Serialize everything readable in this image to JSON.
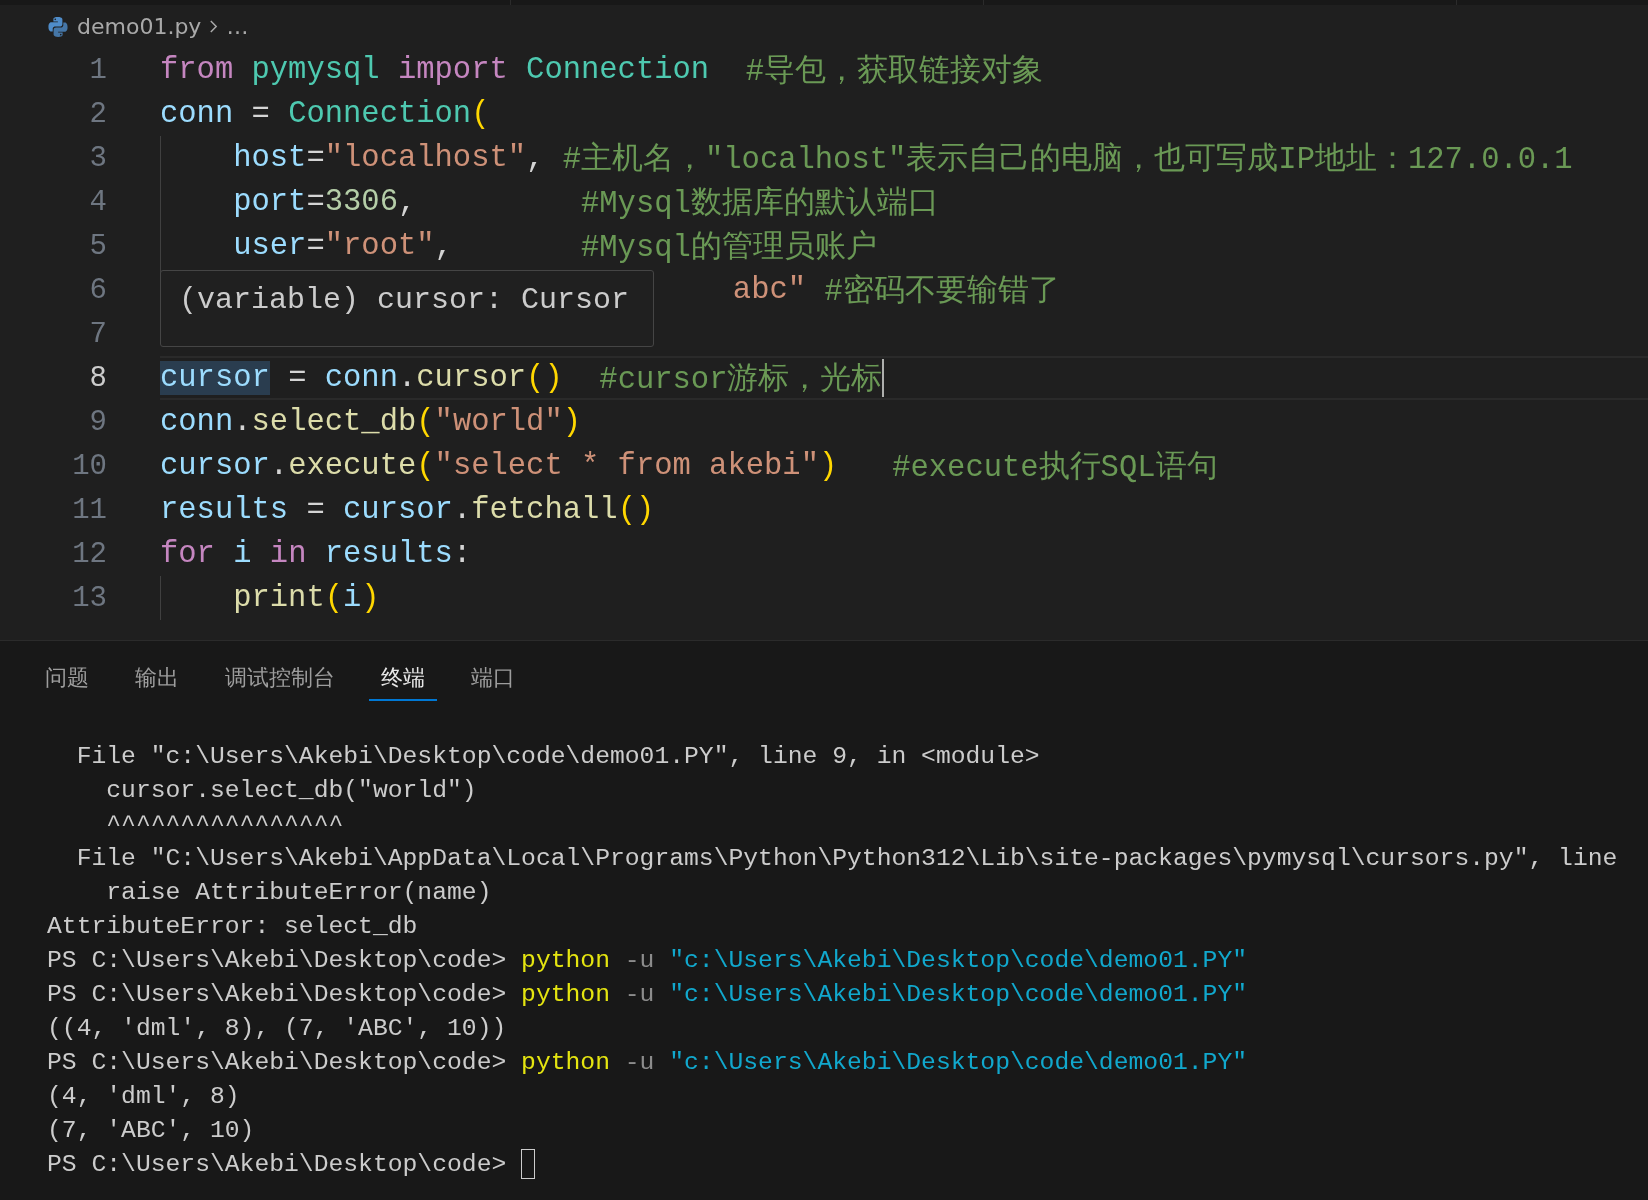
{
  "breadcrumb": {
    "file": "demo01.py",
    "rest": "…"
  },
  "code_lines": [
    {
      "number": "1",
      "indented": false,
      "current": false,
      "covered": false,
      "tokens": [
        {
          "kind": "keyword",
          "text": "from "
        },
        {
          "kind": "module",
          "text": "pymysql "
        },
        {
          "kind": "keyword",
          "text": "import "
        },
        {
          "kind": "class",
          "text": "Connection  "
        },
        {
          "kind": "comment",
          "text": "#导包，获取链接对象"
        }
      ]
    },
    {
      "number": "2",
      "indented": false,
      "current": false,
      "covered": false,
      "tokens": [
        {
          "kind": "var",
          "text": "conn"
        },
        {
          "kind": "plain",
          "text": " = "
        },
        {
          "kind": "class",
          "text": "Connection"
        },
        {
          "kind": "bracket",
          "text": "("
        }
      ]
    },
    {
      "number": "3",
      "indented": true,
      "current": false,
      "covered": false,
      "tokens": [
        {
          "kind": "var",
          "text": "host"
        },
        {
          "kind": "plain",
          "text": "="
        },
        {
          "kind": "string",
          "text": "\"localhost\""
        },
        {
          "kind": "plain",
          "text": ", "
        },
        {
          "kind": "comment",
          "text": "#主机名，\"localhost\"表示自己的电脑，也可写成IP地址：127.0.0.1"
        }
      ]
    },
    {
      "number": "4",
      "indented": true,
      "current": false,
      "covered": false,
      "tokens": [
        {
          "kind": "var",
          "text": "port"
        },
        {
          "kind": "plain",
          "text": "="
        },
        {
          "kind": "number",
          "text": "3306"
        },
        {
          "kind": "plain",
          "text": ",         "
        },
        {
          "kind": "comment",
          "text": "#Mysql数据库的默认端口"
        }
      ]
    },
    {
      "number": "5",
      "indented": true,
      "current": false,
      "covered": false,
      "tokens": [
        {
          "kind": "var",
          "text": "user"
        },
        {
          "kind": "plain",
          "text": "="
        },
        {
          "kind": "string",
          "text": "\"root\""
        },
        {
          "kind": "plain",
          "text": ",       "
        },
        {
          "kind": "comment",
          "text": "#Mysql的管理员账户"
        }
      ]
    },
    {
      "number": "6",
      "indented": true,
      "current": false,
      "covered": true,
      "tokens": [
        {
          "kind": "string",
          "text": "abc\""
        },
        {
          "kind": "comment",
          "text": " #密码不要输错了"
        }
      ]
    },
    {
      "number": "7",
      "indented": false,
      "current": false
    },
    {
      "number": "8",
      "indented": false,
      "current": true,
      "covered": false,
      "tokens": [
        {
          "kind": "var",
          "text": "cursor",
          "highlighted": true
        },
        {
          "kind": "plain",
          "text": " = "
        },
        {
          "kind": "var",
          "text": "conn"
        },
        {
          "kind": "plain",
          "text": "."
        },
        {
          "kind": "func",
          "text": "cursor"
        },
        {
          "kind": "bracket",
          "text": "()"
        },
        {
          "kind": "comment",
          "text": "  #cursor游标，光标"
        }
      ]
    },
    {
      "number": "9",
      "indented": false,
      "current": false,
      "covered": false,
      "tokens": [
        {
          "kind": "var",
          "text": "conn"
        },
        {
          "kind": "plain",
          "text": "."
        },
        {
          "kind": "func",
          "text": "select_db"
        },
        {
          "kind": "bracket",
          "text": "("
        },
        {
          "kind": "string",
          "text": "\"world\""
        },
        {
          "kind": "bracket",
          "text": ")"
        }
      ]
    },
    {
      "number": "10",
      "indented": false,
      "current": false,
      "covered": false,
      "tokens": [
        {
          "kind": "var",
          "text": "cursor"
        },
        {
          "kind": "plain",
          "text": "."
        },
        {
          "kind": "func",
          "text": "execute"
        },
        {
          "kind": "bracket",
          "text": "("
        },
        {
          "kind": "string",
          "text": "\"select * from akebi\""
        },
        {
          "kind": "bracket",
          "text": ")"
        },
        {
          "kind": "comment",
          "text": "   #execute执行SQL语句"
        }
      ]
    },
    {
      "number": "11",
      "indented": false,
      "current": false,
      "covered": false,
      "tokens": [
        {
          "kind": "var",
          "text": "results"
        },
        {
          "kind": "plain",
          "text": " = "
        },
        {
          "kind": "var",
          "text": "cursor"
        },
        {
          "kind": "plain",
          "text": "."
        },
        {
          "kind": "func",
          "text": "fetchall"
        },
        {
          "kind": "bracket",
          "text": "()"
        }
      ]
    },
    {
      "number": "12",
      "indented": false,
      "current": false,
      "covered": false,
      "tokens": [
        {
          "kind": "keyword",
          "text": "for "
        },
        {
          "kind": "var",
          "text": "i "
        },
        {
          "kind": "keyword",
          "text": "in "
        },
        {
          "kind": "var",
          "text": "results"
        },
        {
          "kind": "plain",
          "text": ":"
        }
      ]
    },
    {
      "number": "13",
      "indented": true,
      "current": false,
      "covered": false,
      "tokens": [
        {
          "kind": "func",
          "text": "print"
        },
        {
          "kind": "bracket",
          "text": "("
        },
        {
          "kind": "var",
          "text": "i"
        },
        {
          "kind": "bracket",
          "text": ")"
        }
      ]
    }
  ],
  "hover_tooltip": {
    "text": "(variable) cursor: Cursor"
  },
  "panel_tabs": [
    {
      "label": "问题",
      "selected": false
    },
    {
      "label": "输出",
      "selected": false
    },
    {
      "label": "调试控制台",
      "selected": false
    },
    {
      "label": "终端",
      "selected": true
    },
    {
      "label": "端口",
      "selected": false
    }
  ],
  "terminal_lines": [
    {
      "segments": [
        {
          "kind": "plain",
          "text": "  File \"c:\\Users\\Akebi\\Desktop\\code\\demo01.PY\", line 9, in <module>"
        }
      ]
    },
    {
      "segments": [
        {
          "kind": "plain",
          "text": "    cursor.select_db(\"world\")"
        }
      ]
    },
    {
      "segments": [
        {
          "kind": "plain",
          "text": "    ^^^^^^^^^^^^^^^^"
        }
      ]
    },
    {
      "segments": [
        {
          "kind": "plain",
          "text": "  File \"C:\\Users\\Akebi\\AppData\\Local\\Programs\\Python\\Python312\\Lib\\site-packages\\pymysql\\cursors.py\", line"
        }
      ]
    },
    {
      "segments": [
        {
          "kind": "plain",
          "text": "    raise AttributeError(name)"
        }
      ]
    },
    {
      "segments": [
        {
          "kind": "plain",
          "text": "AttributeError: select_db"
        }
      ]
    },
    {
      "segments": [
        {
          "kind": "plain",
          "text": "PS C:\\Users\\Akebi\\Desktop\\code> "
        },
        {
          "kind": "command",
          "text": "python"
        },
        {
          "kind": "flag",
          "text": " -u "
        },
        {
          "kind": "string",
          "text": "\"c:\\Users\\Akebi\\Desktop\\code\\demo01.PY\""
        }
      ]
    },
    {
      "segments": [
        {
          "kind": "plain",
          "text": "PS C:\\Users\\Akebi\\Desktop\\code> "
        },
        {
          "kind": "command",
          "text": "python"
        },
        {
          "kind": "flag",
          "text": " -u "
        },
        {
          "kind": "string",
          "text": "\"c:\\Users\\Akebi\\Desktop\\code\\demo01.PY\""
        }
      ]
    },
    {
      "segments": [
        {
          "kind": "plain",
          "text": "((4, 'dml', 8), (7, 'ABC', 10))"
        }
      ]
    },
    {
      "segments": [
        {
          "kind": "plain",
          "text": "PS C:\\Users\\Akebi\\Desktop\\code> "
        },
        {
          "kind": "command",
          "text": "python"
        },
        {
          "kind": "flag",
          "text": " -u "
        },
        {
          "kind": "string",
          "text": "\"c:\\Users\\Akebi\\Desktop\\code\\demo01.PY\""
        }
      ]
    },
    {
      "segments": [
        {
          "kind": "plain",
          "text": "(4, 'dml', 8)"
        }
      ]
    },
    {
      "segments": [
        {
          "kind": "plain",
          "text": "(7, 'ABC', 10)"
        }
      ]
    },
    {
      "segments": [
        {
          "kind": "plain",
          "text": "PS C:\\Users\\Akebi\\Desktop\\code> "
        },
        {
          "kind": "cursor"
        }
      ]
    }
  ]
}
